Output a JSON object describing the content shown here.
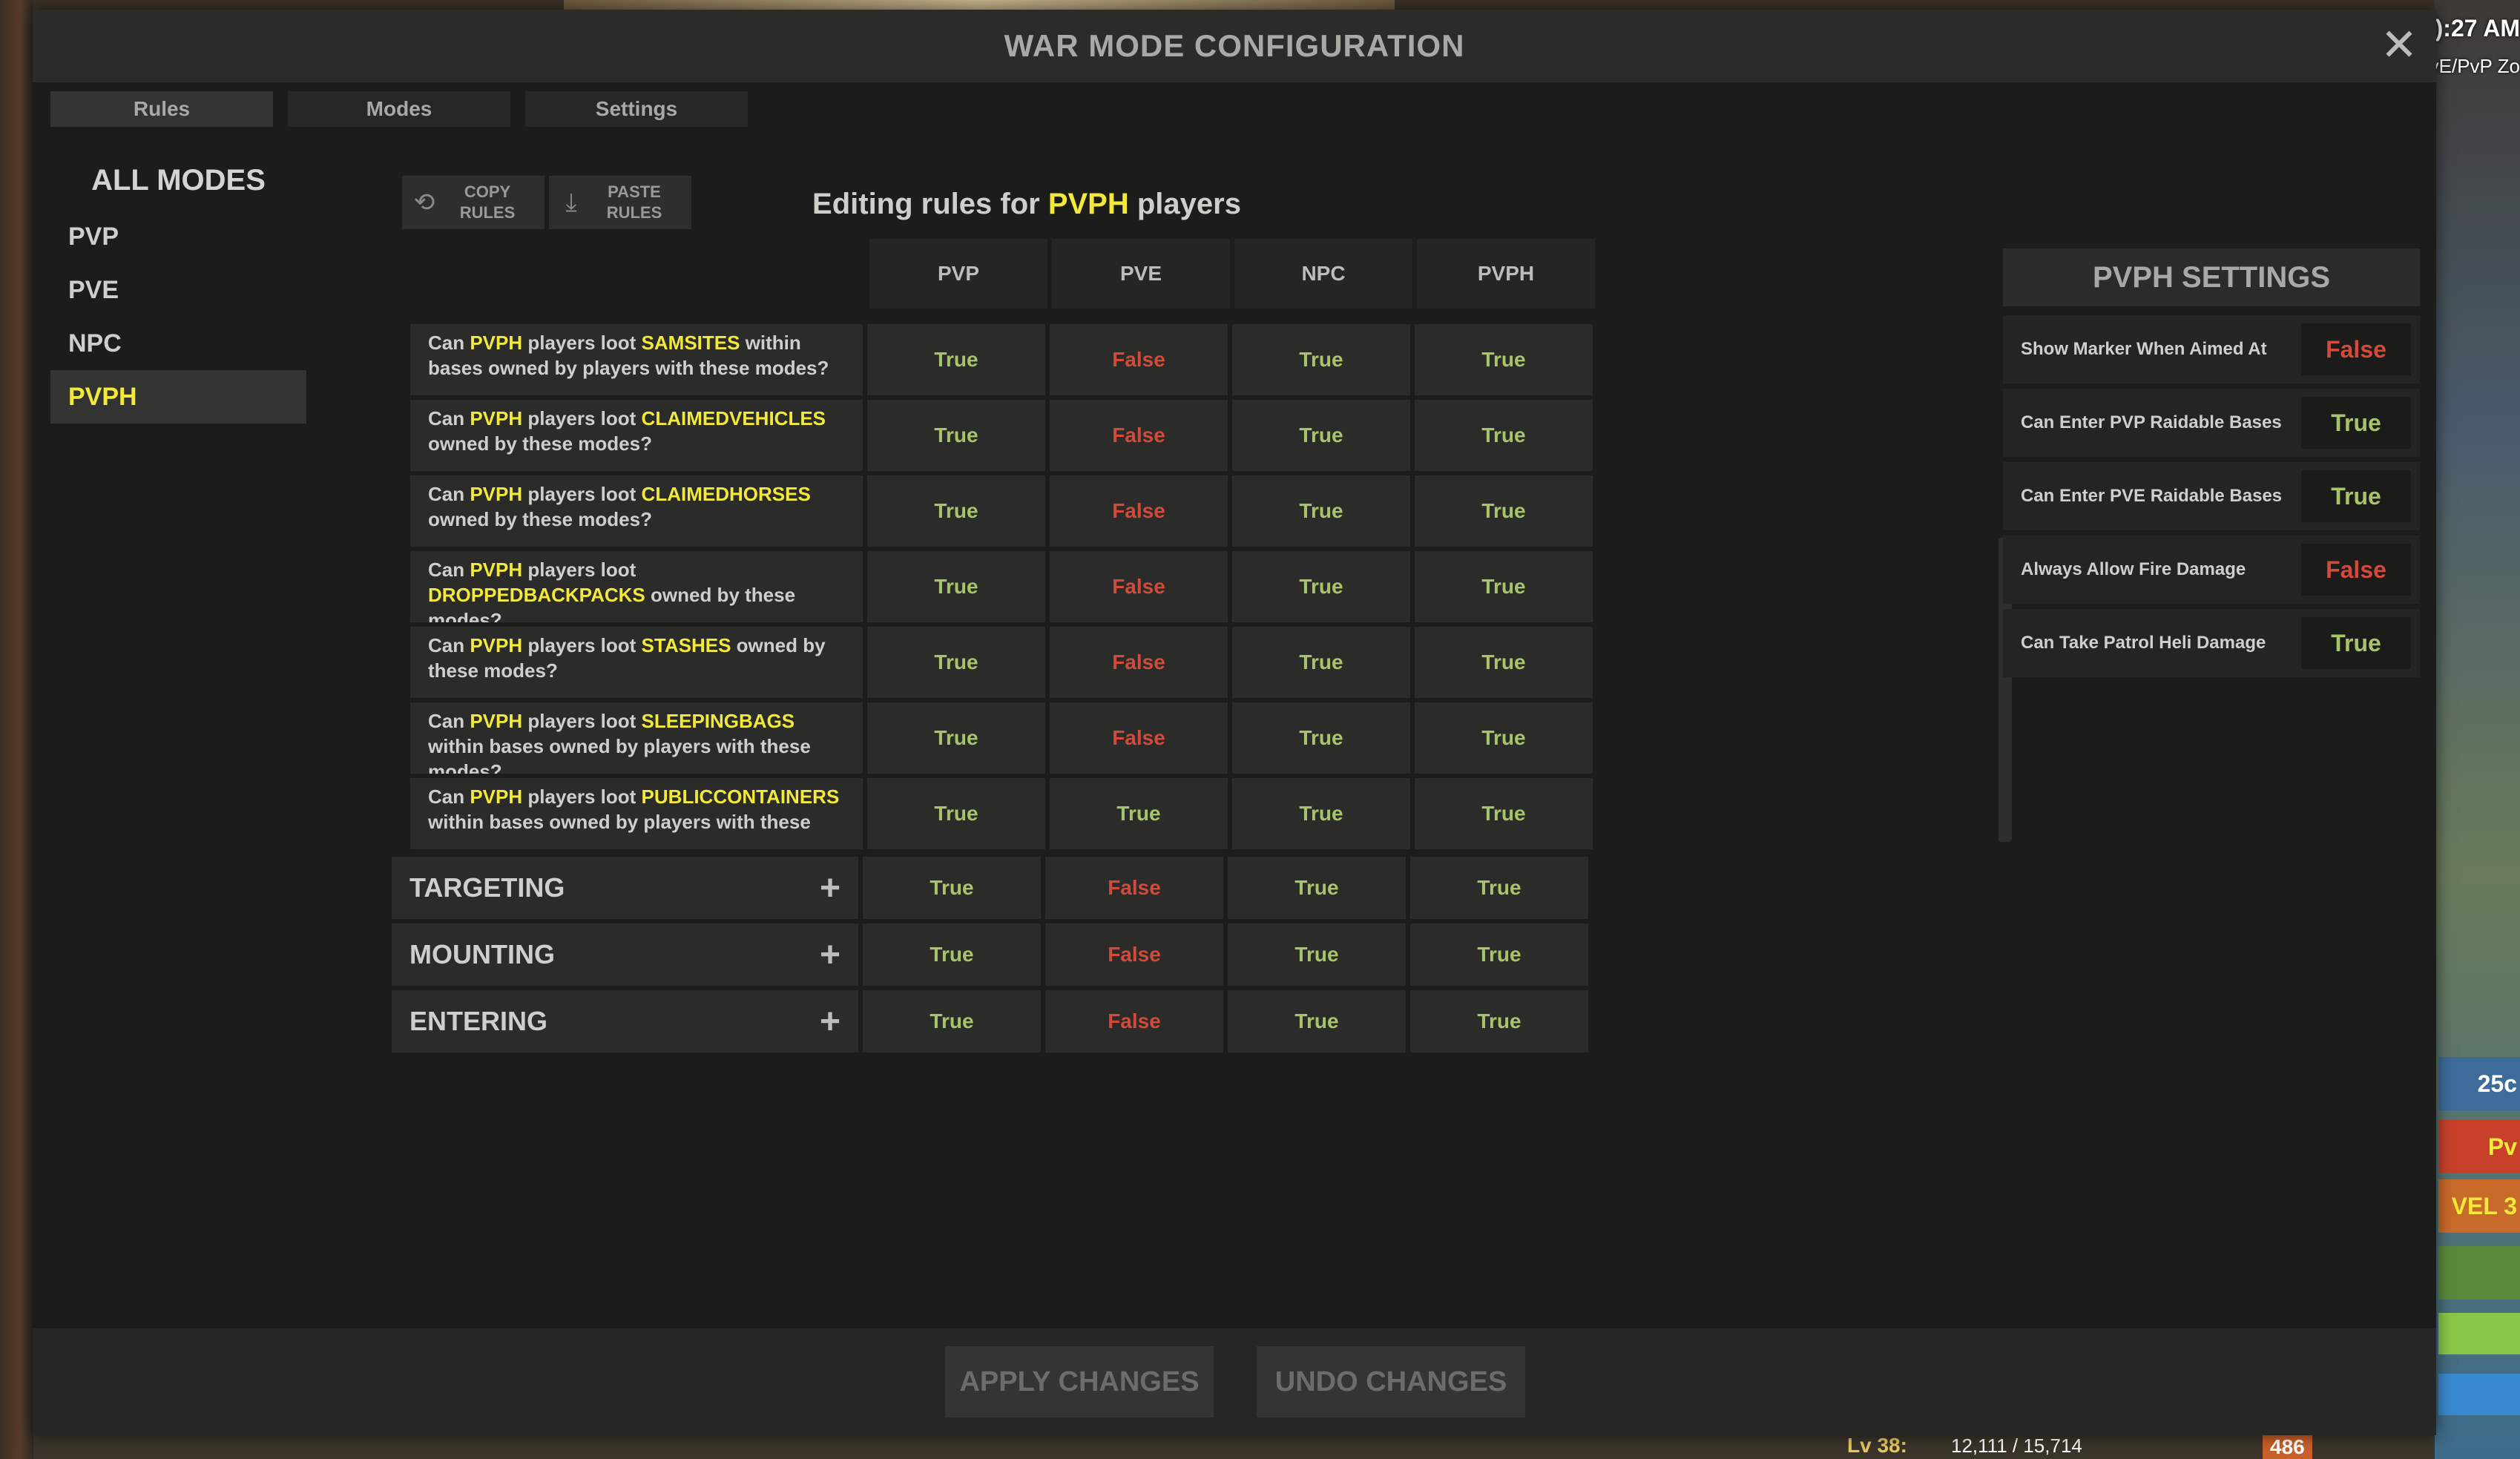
{
  "window": {
    "title": "WAR MODE CONFIGURATION"
  },
  "tabs": [
    "Rules",
    "Modes",
    "Settings"
  ],
  "nav": {
    "header": "ALL MODES",
    "items": [
      "PVP",
      "PVE",
      "NPC",
      "PVPH"
    ],
    "active": "PVPH"
  },
  "toolbar": {
    "copy_line1": "COPY",
    "copy_line2": "RULES",
    "paste_line1": "PASTE",
    "paste_line2": "RULES"
  },
  "editing": {
    "prefix": "Editing rules for ",
    "mode": "PVPH",
    "suffix": " players"
  },
  "columns": [
    "PVP",
    "PVE",
    "NPC",
    "PVPH"
  ],
  "rules": [
    {
      "before": "Can ",
      "mode": "PVPH",
      "mid": " players loot ",
      "item": "SAMSITES",
      "after": " within bases owned by players with these modes?",
      "values": [
        "True",
        "False",
        "True",
        "True"
      ]
    },
    {
      "before": "Can ",
      "mode": "PVPH",
      "mid": " players loot ",
      "item": "CLAIMEDVEHICLES",
      "after": " owned by these modes?",
      "values": [
        "True",
        "False",
        "True",
        "True"
      ]
    },
    {
      "before": "Can ",
      "mode": "PVPH",
      "mid": " players loot ",
      "item": "CLAIMEDHORSES",
      "after": " owned by these modes?",
      "values": [
        "True",
        "False",
        "True",
        "True"
      ]
    },
    {
      "before": "Can ",
      "mode": "PVPH",
      "mid": " players loot ",
      "item": "DROPPEDBACKPACKS",
      "after": " owned by these modes?",
      "values": [
        "True",
        "False",
        "True",
        "True"
      ]
    },
    {
      "before": "Can ",
      "mode": "PVPH",
      "mid": " players loot ",
      "item": "STASHES",
      "after": " owned by these modes?",
      "values": [
        "True",
        "False",
        "True",
        "True"
      ]
    },
    {
      "before": "Can ",
      "mode": "PVPH",
      "mid": " players loot ",
      "item": "SLEEPINGBAGS",
      "after": " within bases owned by players with these modes?",
      "values": [
        "True",
        "False",
        "True",
        "True"
      ]
    },
    {
      "before": "Can ",
      "mode": "PVPH",
      "mid": " players loot ",
      "item": "PUBLICCONTAINERS",
      "after": " within bases owned by players with these",
      "values": [
        "True",
        "True",
        "True",
        "True"
      ]
    }
  ],
  "groups": [
    {
      "label": "TARGETING",
      "values": [
        "True",
        "False",
        "True",
        "True"
      ]
    },
    {
      "label": "MOUNTING",
      "values": [
        "True",
        "False",
        "True",
        "True"
      ]
    },
    {
      "label": "ENTERING",
      "values": [
        "True",
        "False",
        "True",
        "True"
      ]
    }
  ],
  "settings": {
    "header": "PVPH SETTINGS",
    "rows": [
      {
        "label": "Show Marker When Aimed At",
        "value": "False"
      },
      {
        "label": "Can Enter PVP Raidable Bases",
        "value": "True"
      },
      {
        "label": "Can Enter PVE Raidable Bases",
        "value": "True"
      },
      {
        "label": "Always Allow Fire Damage",
        "value": "False"
      },
      {
        "label": "Can Take Patrol Heli Damage",
        "value": "True"
      }
    ]
  },
  "footer": {
    "apply": "APPLY CHANGES",
    "undo": "UNDO CHANGES"
  },
  "hud": {
    "time": "):27 AM",
    "zone": "vE/PvP Zo",
    "side": [
      "25c",
      "Pv",
      "VEL 3"
    ],
    "level": "Lv 38:",
    "xp": "12,111 / 15,714",
    "xp2": "486"
  },
  "colors": {
    "true": "#a8c46a",
    "false": "#d24a3a",
    "highlight": "#f2e93a"
  }
}
